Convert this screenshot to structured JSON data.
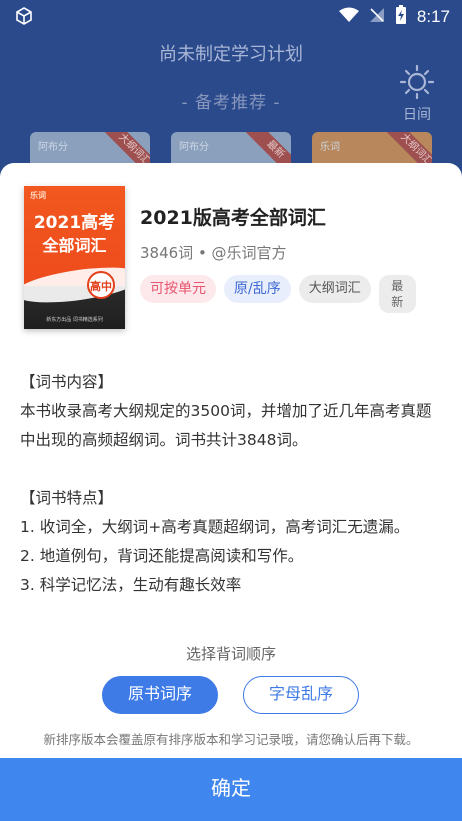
{
  "status_bar": {
    "time": "8:17"
  },
  "background": {
    "title": "尚未制定学习计划",
    "subtitle": "- 备考推荐 -",
    "daytime_label": "日间",
    "cards": [
      {
        "brand": "阿布分",
        "ribbon": "大纲词汇"
      },
      {
        "brand": "阿布分",
        "ribbon": "最新"
      },
      {
        "brand": "乐词",
        "ribbon": "大纲词汇"
      }
    ]
  },
  "book": {
    "cover": {
      "brand": "乐词",
      "line1": "2021高考",
      "line2": "全部词汇",
      "badge": "高中",
      "footer": "新东方出品 词书精选系列"
    },
    "title": "2021版高考全部词汇",
    "meta": "3846词 • @乐词官方",
    "tags": [
      "可按单元",
      "原/乱序",
      "大纲词汇"
    ],
    "latest_tag": [
      "最",
      "新"
    ]
  },
  "description": {
    "heading1": "【词书内容】",
    "content": "本书收录高考大纲规定的3500词，并增加了近几年高考真题中出现的高频超纲词。词书共计3848词。",
    "heading2": "【词书特点】",
    "point1": "1. 收词全，大纲词+高考真题超纲词，高考词汇无遗漏。",
    "point2": "2. 地道例句，背词还能提高阅读和写作。",
    "point3": "3. 科学记忆法，生动有趣长效率"
  },
  "order_panel": {
    "title": "选择背词顺序",
    "option_original": "原书词序",
    "option_shuffled": "字母乱序",
    "note": "新排序版本会覆盖原有排序版本和学习记录哦，请您确认后再下载。",
    "confirm": "确定"
  },
  "colors": {
    "primary": "#3f86ee",
    "tag_pink": "#e8556e",
    "tag_blue": "#3e6ad4",
    "background_blue": "#2a4a8c"
  }
}
